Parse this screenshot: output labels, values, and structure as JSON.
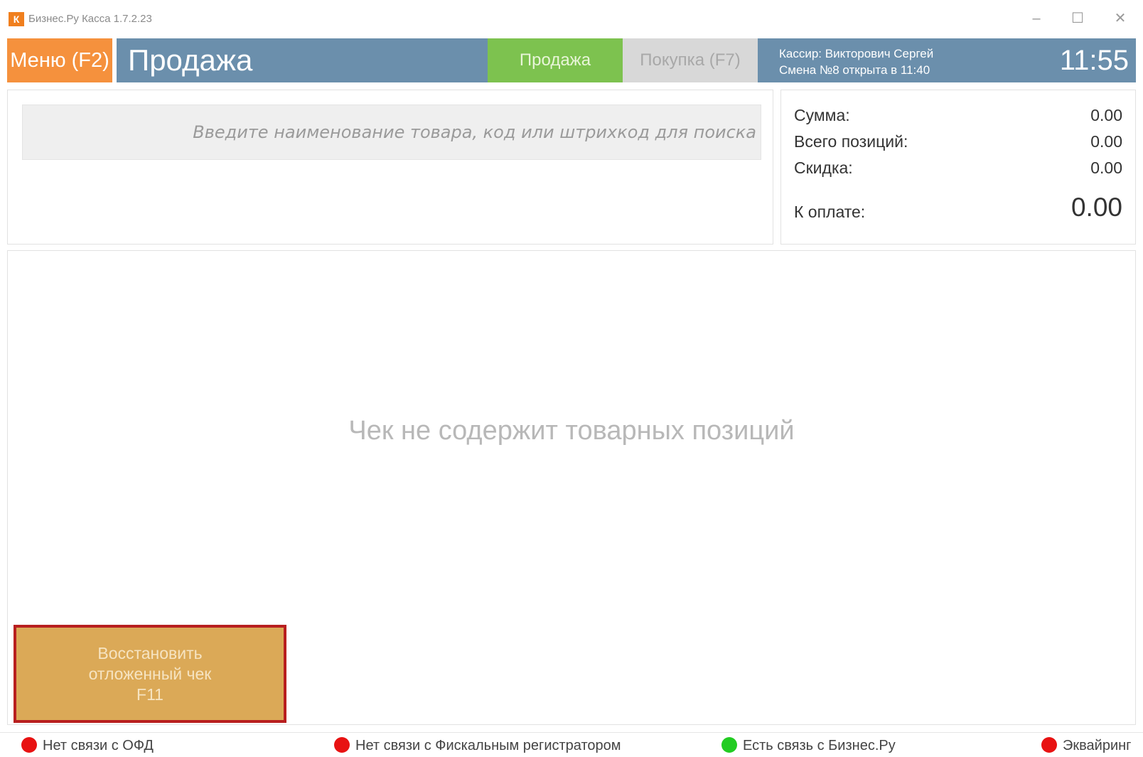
{
  "window": {
    "logo_letter": "К",
    "title": "Бизнес.Ру Касса 1.7.2.23",
    "minimize": "–",
    "maximize": "☐",
    "close": "✕"
  },
  "header": {
    "menu_label": "Меню (F2)",
    "page_title": "Продажа",
    "tabs": [
      {
        "label": "Продажа",
        "active": true
      },
      {
        "label": "Покупка (F7)",
        "active": false
      }
    ],
    "cashier": "Кассир: Викторович Сергей",
    "shift": "Смена №8 открыта в 11:40",
    "time": "11:55"
  },
  "search": {
    "placeholder": "Введите наименование товара, код или штрихкод для поиска"
  },
  "totals": {
    "sum_label": "Сумма:",
    "sum_value": "0.00",
    "positions_label": "Всего позиций:",
    "positions_value": "0.00",
    "discount_label": "Скидка:",
    "discount_value": "0.00",
    "to_pay_label": "К оплате:",
    "to_pay_value": "0.00"
  },
  "receipt": {
    "empty_message": "Чек не содержит товарных позиций",
    "restore_button": [
      "Восстановить",
      "отложенный чек",
      "F11"
    ]
  },
  "status_bar": [
    {
      "label": "Нет связи с ОФД",
      "color": "#e81212",
      "icon": "red-status-dot"
    },
    {
      "label": "Нет связи с Фискальным регистратором",
      "color": "#e81212",
      "icon": "red-status-dot"
    },
    {
      "label": "Есть связь с Бизнес.Ру",
      "color": "#22cc22",
      "icon": "green-status-dot"
    },
    {
      "label": "Эквайринг",
      "color": "#e81212",
      "icon": "red-status-dot"
    }
  ],
  "colors": {
    "menu": "#f5913d",
    "header": "#6b8fac",
    "active_tab": "#7dc24f",
    "inactive_tab": "#d8d8d8",
    "restore_button": "#dba957",
    "restore_border": "#b81f1f"
  }
}
